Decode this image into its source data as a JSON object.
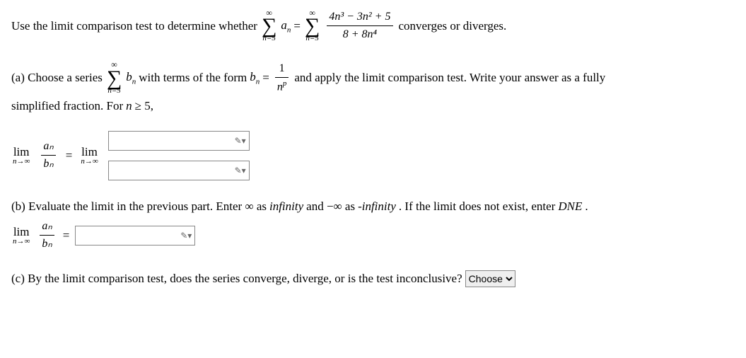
{
  "intro": {
    "pre": "Use the limit comparison test to determine whether ",
    "post": " converges or diverges.",
    "sigma_top": "∞",
    "sigma_bot": "n=5",
    "an": "a",
    "an_sub": "n",
    "eq": " = ",
    "frac_num": "4n³ − 3n² + 5",
    "frac_den": "8 + 8n⁴"
  },
  "partA": {
    "label": "(a) Choose a series ",
    "sigma_top": "∞",
    "sigma_bot": "n=5",
    "bn": "b",
    "bn_sub": "n",
    "mid1": " with terms of the form ",
    "eq": " = ",
    "frac_num": "1",
    "frac_den_n": "n",
    "frac_den_p": "p",
    "mid2": " and apply the limit comparison test. Write your answer as a fully",
    "line2a": "simplified fraction. For ",
    "n": "n",
    "geq": " ≥ 5,",
    "lim": "lim",
    "lim_sub": "n→∞",
    "frac2_num": "aₙ",
    "frac2_den": "bₙ",
    "eq2": " = ",
    "handle": "✎▾"
  },
  "partB": {
    "text": "(b) Evaluate the limit in the previous part. Enter ∞ as ",
    "inf": "infinity",
    "text2": " and −∞ as ",
    "ninf": "-infinity",
    "text3": ". If the limit does not exist, enter ",
    "dne": "DNE",
    "period": ".",
    "lim": "lim",
    "lim_sub": "n→∞",
    "frac_num": "aₙ",
    "frac_den": "bₙ",
    "eq": " = ",
    "handle": "✎▾"
  },
  "partC": {
    "text": "(c) By the limit comparison test, does the series converge, diverge, or is the test inconclusive? ",
    "select": "Choose"
  }
}
